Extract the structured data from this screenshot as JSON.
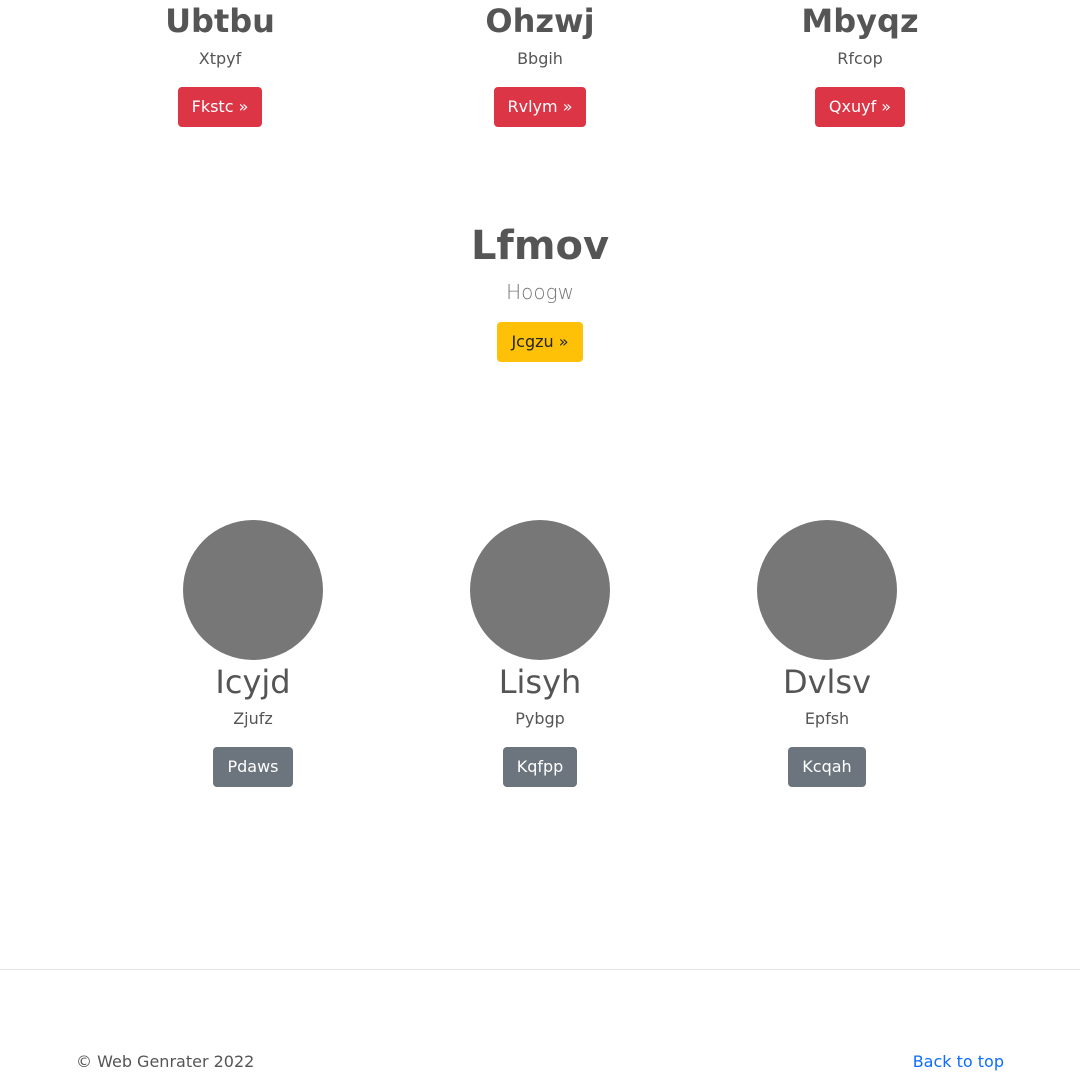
{
  "top_features": [
    {
      "title": "Ubtbu",
      "subtitle": "Xtpyf",
      "button": "Fkstc »"
    },
    {
      "title": "Ohzwj",
      "subtitle": "Bbgih",
      "button": "Rvlym »"
    },
    {
      "title": "Mbyqz",
      "subtitle": "Rfcop",
      "button": "Qxuyf »"
    }
  ],
  "hero": {
    "title": "Lfmov",
    "subtitle": "Hoogw",
    "button": "Jcgzu »"
  },
  "team": [
    {
      "name": "Icyjd",
      "subtitle": "Zjufz",
      "button": "Pdaws"
    },
    {
      "name": "Lisyh",
      "subtitle": "Pybgp",
      "button": "Kqfpp"
    },
    {
      "name": "Dvlsv",
      "subtitle": "Epfsh",
      "button": "Kcqah"
    }
  ],
  "footer": {
    "copyright": "© Web Genrater 2022",
    "back_to_top": "Back to top"
  },
  "colors": {
    "danger": "#dc3545",
    "warning": "#ffc107",
    "secondary": "#6c757d",
    "link": "#0d6efd",
    "avatar": "#777777"
  }
}
